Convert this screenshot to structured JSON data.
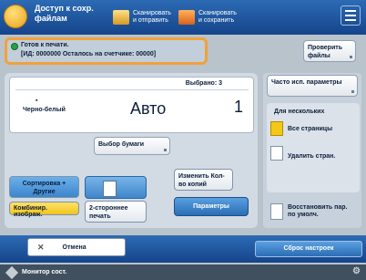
{
  "topbar": {
    "title": "Доступ к сохр. файлам",
    "tab1": "Сканировать и отправить",
    "tab2": "Сканировать и сохранить",
    "menu_icon": "hamburger-icon"
  },
  "status": {
    "line1": "Готов к печати.",
    "line2": "[ИД: 0000000 Осталось на счетчике: 00000]",
    "check_files_button": "Проверить файлы"
  },
  "main": {
    "selected_header": "Выбрано: 3",
    "color_mode": "Черно-белый",
    "paper": "Авто",
    "copies": "1",
    "paper_select_button": "Выбор бумаги",
    "change_copies_button": "Изменить Кол-во копий",
    "sort_group_button": "Сортировка + Другие",
    "combine_button": "Комбинир. изображ.",
    "duplex_button": "2-стороннее печать",
    "options_button": "Параметры"
  },
  "right_panel": {
    "frequent_settings": "Часто исп. параметры",
    "multi_heading": "Для нескольких",
    "all_pages": "Все страницы",
    "remove_pages": "Удалить стран.",
    "restore_defaults": "Восстановить пар. по умолч."
  },
  "bottom": {
    "stop_label": "Отмена",
    "reset_label": "Сброс настроек"
  },
  "footer": {
    "monitor_label": "Монитор сост."
  }
}
